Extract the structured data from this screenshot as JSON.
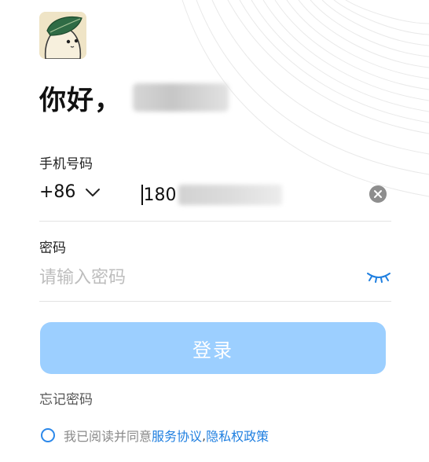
{
  "header": {
    "greeting": "你好，",
    "avatar_icon": "leaf-creature-avatar-icon"
  },
  "phone": {
    "label": "手机号码",
    "country_code": "+86",
    "value_visible": "180",
    "clear_icon": "clear-x-icon"
  },
  "password": {
    "label": "密码",
    "placeholder": "请输入密码",
    "toggle_icon": "eye-closed-icon"
  },
  "actions": {
    "login_label": "登录",
    "forgot_label": "忘记密码"
  },
  "agreement": {
    "prefix": "我已阅读并同意",
    "service_link": "服务协议",
    "separator": ",",
    "privacy_link": "隐私权政策"
  },
  "colors": {
    "accent": "#1f7fe0",
    "login_button_disabled": "#9ccfff",
    "placeholder": "#bdbdbd",
    "divider": "#e3e3e3"
  }
}
